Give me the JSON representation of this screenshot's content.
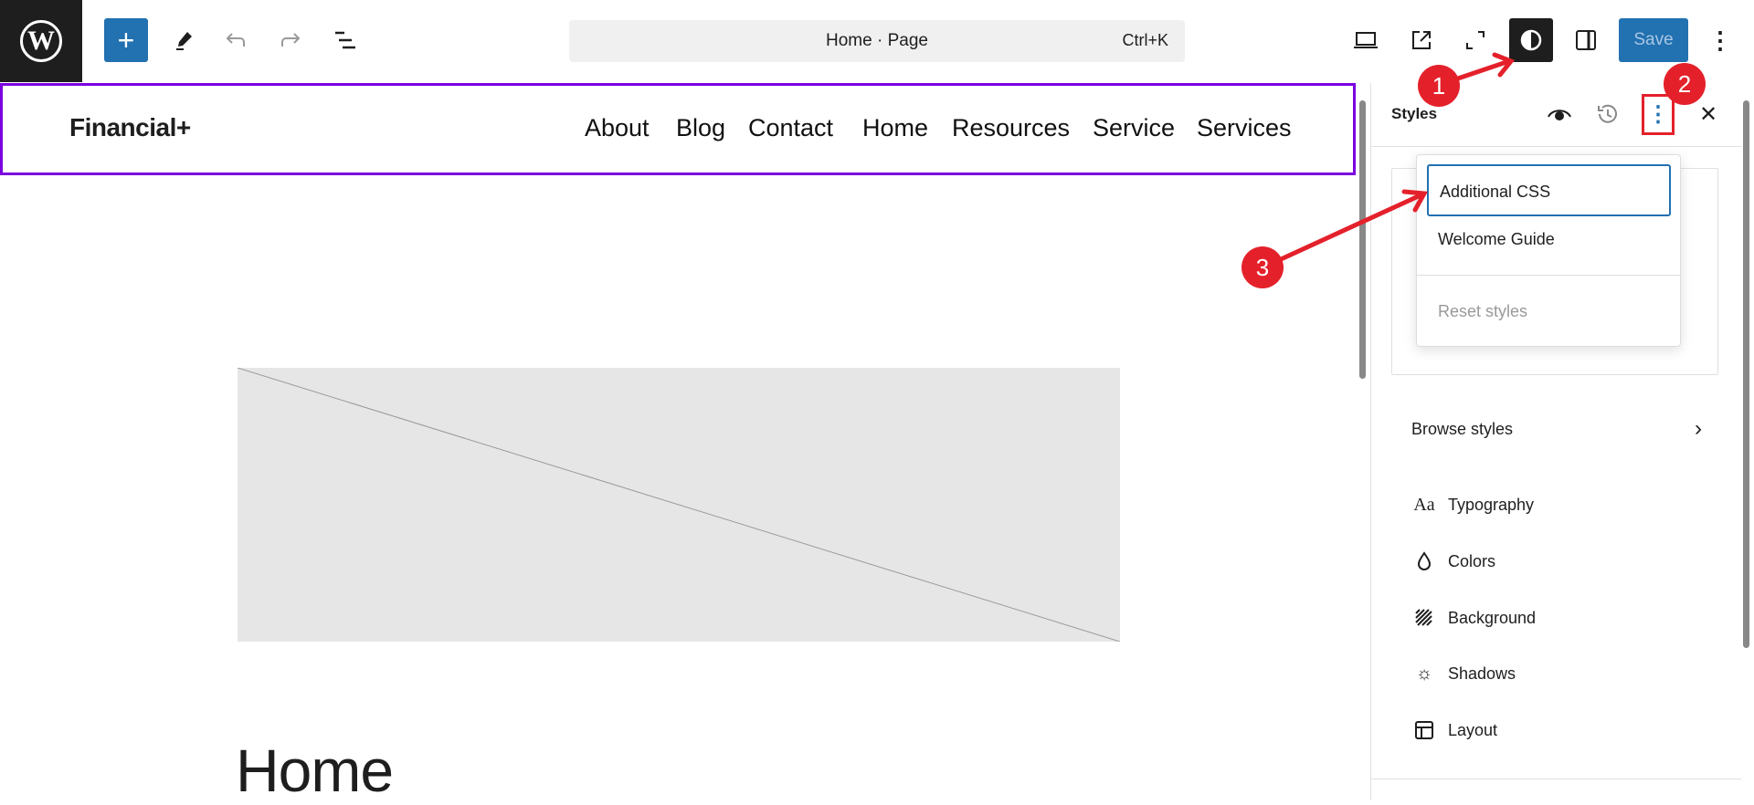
{
  "toolbar": {
    "command_bar": "Home · Page",
    "command_shortcut": "Ctrl+K",
    "save_label": "Save",
    "icons": [
      "wordpress-logo",
      "plus-icon",
      "pen-icon",
      "undo-icon",
      "redo-icon",
      "list-view-icon",
      "laptop-icon",
      "external-link-icon",
      "fullscreen-icon",
      "styles-contrast-icon",
      "sidebar-icon",
      "more-vertical-icon"
    ]
  },
  "site": {
    "brand": "Financial+",
    "nav": [
      "About",
      "Blog",
      "Contact",
      "Home",
      "Resources",
      "Service",
      "Services"
    ],
    "page_heading": "Home"
  },
  "sidebar": {
    "title": "Styles",
    "menu": {
      "items": [
        "Additional CSS",
        "Welcome Guide"
      ],
      "reset": "Reset styles"
    },
    "browse": "Browse styles",
    "items": [
      {
        "label": "Typography",
        "icon": "Aa"
      },
      {
        "label": "Colors",
        "icon": "droplet-icon"
      },
      {
        "label": "Background",
        "icon": "background-icon"
      },
      {
        "label": "Shadows",
        "icon": "sun-icon"
      },
      {
        "label": "Layout",
        "icon": "layout-icon"
      }
    ]
  },
  "annotations": [
    "1",
    "2",
    "3"
  ],
  "colors": {
    "accent": "#2271b1",
    "frame": "#7a00df",
    "annotation": "#e4212b"
  }
}
